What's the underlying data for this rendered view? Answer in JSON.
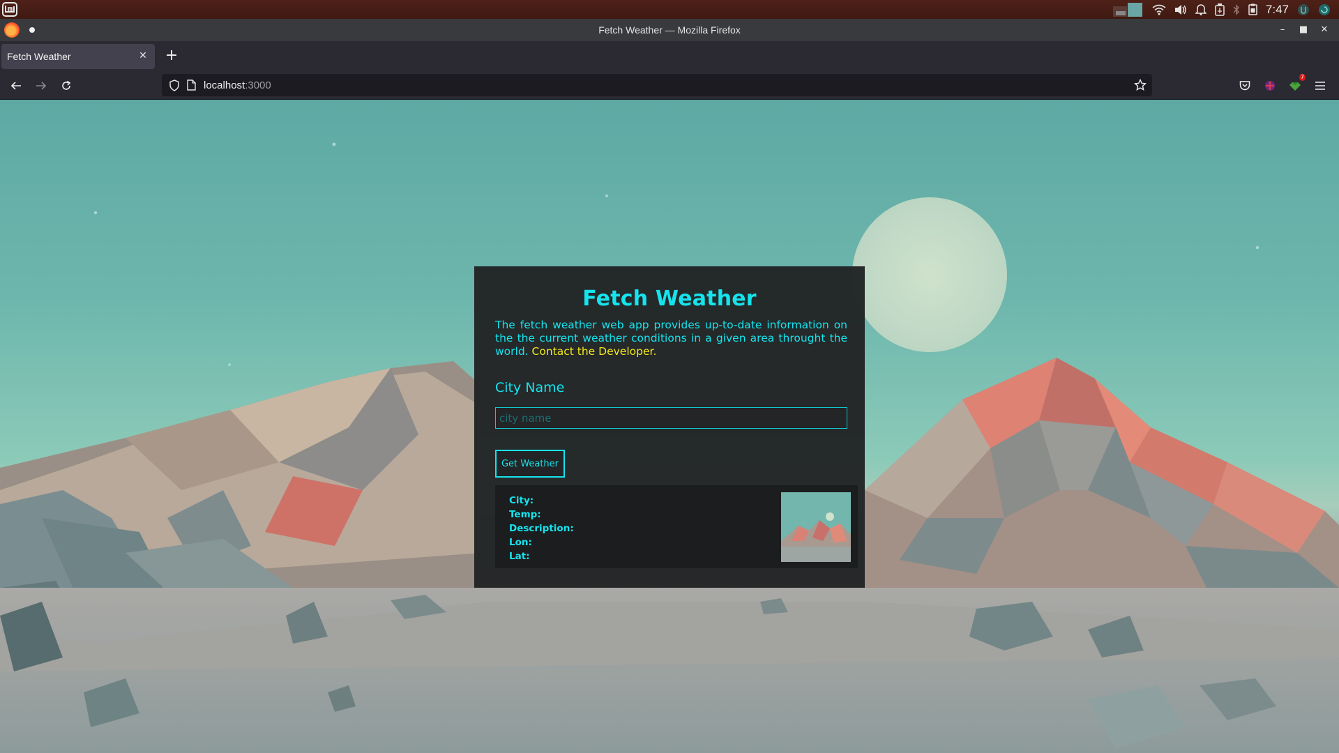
{
  "system": {
    "clock": "7:47",
    "icons": [
      "workspace-switcher",
      "wifi-icon",
      "volume-icon",
      "bell-icon",
      "battery-usb-icon",
      "bluetooth-icon",
      "clipboard-icon",
      "update-icon"
    ]
  },
  "window": {
    "title": "Fetch Weather — Mozilla Firefox",
    "controls": [
      "minimize",
      "maximize",
      "close"
    ]
  },
  "tabs": [
    {
      "title": "Fetch Weather"
    }
  ],
  "navbar": {
    "url_host": "localhost",
    "url_port": ":3000",
    "badge_count": "7"
  },
  "app": {
    "title": "Fetch Weather",
    "description": "The fetch weather web app provides up-to-date information on the the current weather conditions in a given area throught the world.",
    "contact_link": "Contact the Developer.",
    "city_label": "City Name",
    "city_placeholder": "city name",
    "city_value": "",
    "button_label": "Get Weather",
    "result": {
      "city_label": "City:",
      "temp_label": "Temp:",
      "description_label": "Description:",
      "lon_label": "Lon:",
      "lat_label": "Lat:"
    }
  },
  "colors": {
    "accent": "#15e4ee",
    "link": "#f2e81d",
    "card_bg": "#222425",
    "panel_bg": "#4e2118"
  }
}
